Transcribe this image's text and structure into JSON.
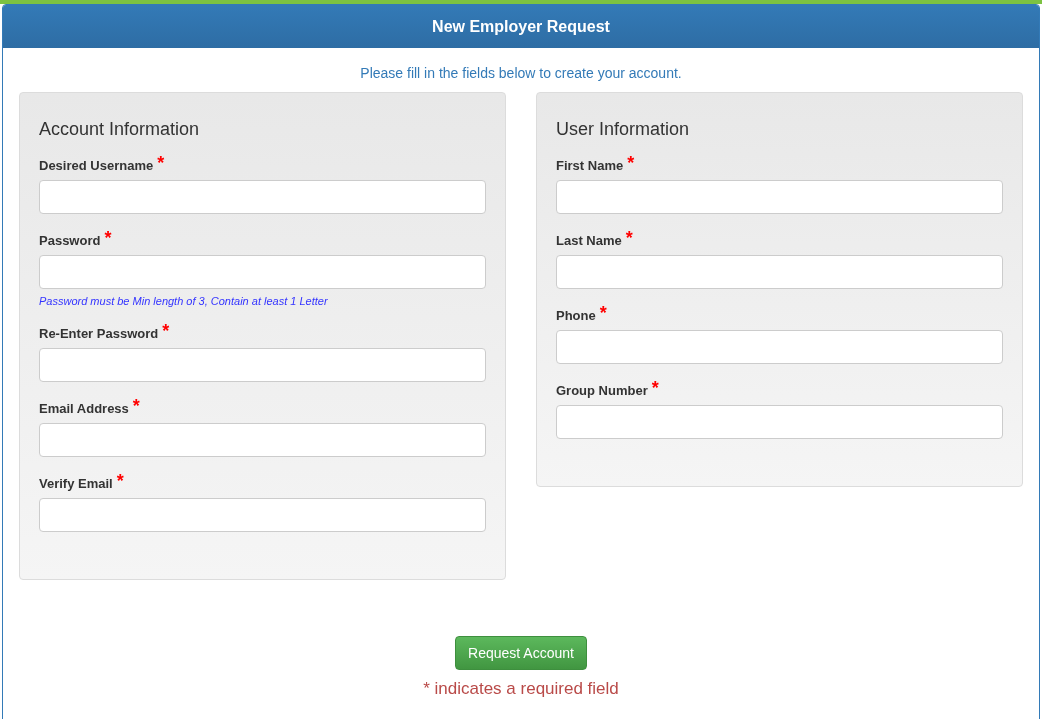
{
  "window": {
    "title": "New Employer Request"
  },
  "intro": "Please fill in the fields below to create your account.",
  "sections": [
    {
      "title": "Account Information",
      "fields": [
        {
          "label": "Desired Username",
          "required_mark": "*"
        },
        {
          "label": "Password",
          "required_mark": "*",
          "hint": "Password must be Min length of 3, Contain at least 1 Letter"
        },
        {
          "label": "Re-Enter Password",
          "required_mark": "*"
        },
        {
          "label": "Email Address",
          "required_mark": "*"
        },
        {
          "label": "Verify Email",
          "required_mark": "*"
        }
      ]
    },
    {
      "title": "User Information",
      "fields": [
        {
          "label": "First Name",
          "required_mark": "*"
        },
        {
          "label": "Last Name",
          "required_mark": "*"
        },
        {
          "label": "Phone",
          "required_mark": "*"
        },
        {
          "label": "Group Number",
          "required_mark": "*"
        }
      ]
    }
  ],
  "submit_button": "Request Account",
  "footnote": "* indicates a required field"
}
